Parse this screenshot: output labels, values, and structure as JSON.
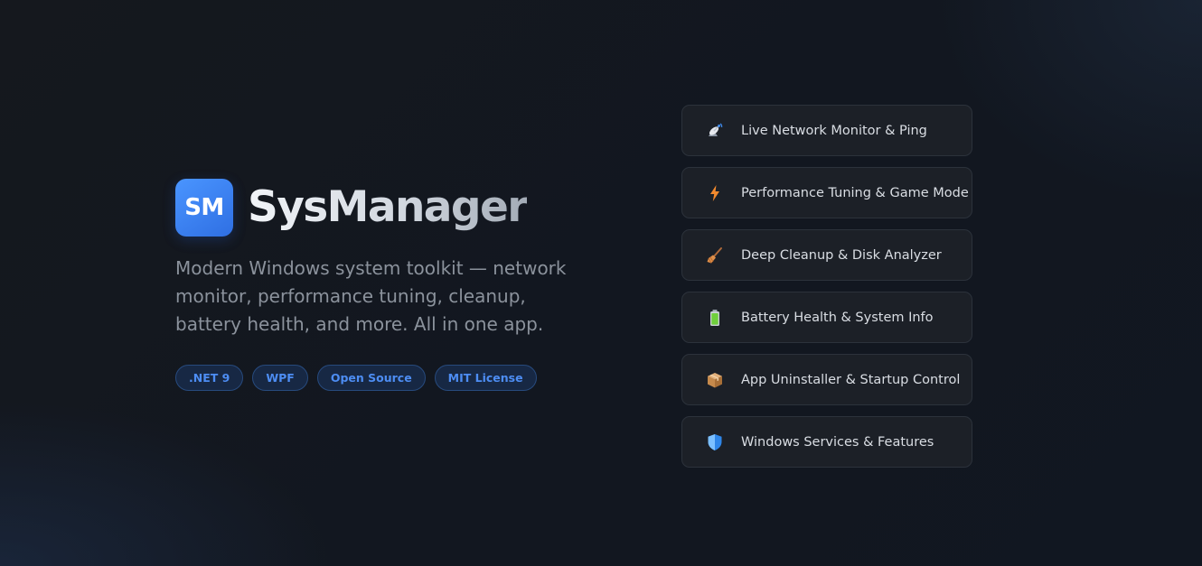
{
  "app": {
    "logo_text": "SM",
    "name": "SysManager",
    "tagline": "Modern Windows system toolkit — network monitor, performance tuning, cleanup, battery health, and more. All in one app."
  },
  "badges": [
    ".NET 9",
    "WPF",
    "Open Source",
    "MIT License"
  ],
  "features": [
    {
      "label": "Live Network Monitor & Ping",
      "icon": "satellite-antenna-icon"
    },
    {
      "label": "Performance Tuning & Game Mode",
      "icon": "lightning-icon"
    },
    {
      "label": "Deep Cleanup & Disk Analyzer",
      "icon": "broom-icon"
    },
    {
      "label": "Battery Health & System Info",
      "icon": "battery-icon"
    },
    {
      "label": "App Uninstaller & Startup Control",
      "icon": "package-icon"
    },
    {
      "label": "Windows Services & Features",
      "icon": "shield-icon"
    }
  ],
  "colors": {
    "accent": "#3b82f6",
    "badge_text": "#4d8df3",
    "background": "#13171e",
    "card_background": "#1c2027"
  }
}
